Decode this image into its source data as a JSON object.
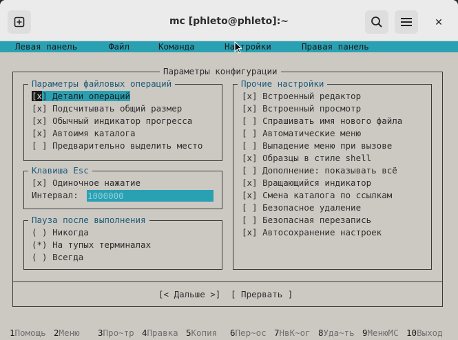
{
  "window": {
    "title": "mc [phleto@phleto]:~",
    "close_glyph": "✕"
  },
  "menubar": {
    "items": [
      "Левая панель",
      "Файл",
      "Команда",
      "Настройки",
      "Правая панель"
    ]
  },
  "dialog": {
    "title": "Параметры конфигурации",
    "file_ops": {
      "title": "Параметры файловых операций",
      "items": [
        {
          "mark": "[x]",
          "label": "Детали операций",
          "checked": true,
          "focused": true
        },
        {
          "mark": "[x]",
          "label": "Подсчитывать общий размер",
          "checked": true
        },
        {
          "mark": "[x]",
          "label": "Обычный индикатор прогресса",
          "checked": true
        },
        {
          "mark": "[x]",
          "label": "Автоимя каталога",
          "checked": true
        },
        {
          "mark": "[ ]",
          "label": "Предварительно выделить место",
          "checked": false
        }
      ]
    },
    "esc_key": {
      "title": "Клавиша Esc",
      "single_press": {
        "mark": "[x]",
        "label": "Одиночное нажатие"
      },
      "interval_label": "Интервал:",
      "interval_value": "1000000"
    },
    "pause": {
      "title": "Пауза после выполнения",
      "options": [
        {
          "mark": "( )",
          "label": "Никогда"
        },
        {
          "mark": "(*)",
          "label": "На тупых терминалах"
        },
        {
          "mark": "( )",
          "label": "Всегда"
        }
      ]
    },
    "other": {
      "title": "Прочие настройки",
      "items": [
        {
          "mark": "[x]",
          "label": "Встроенный редактор"
        },
        {
          "mark": "[x]",
          "label": "Встроенный просмотр"
        },
        {
          "mark": "[ ]",
          "label": "Спрашивать имя нового файла"
        },
        {
          "mark": "[ ]",
          "label": "Автоматические меню"
        },
        {
          "mark": "[ ]",
          "label": "Выпадение меню при вызове"
        },
        {
          "mark": "[x]",
          "label": "Образцы в стиле shell"
        },
        {
          "mark": "[ ]",
          "label": "Дополнение: показывать всё"
        },
        {
          "mark": "[x]",
          "label": "Вращающийся индикатор"
        },
        {
          "mark": "[x]",
          "label": "Смена каталога по ссылкам"
        },
        {
          "mark": "[ ]",
          "label": "Безопасное удаление"
        },
        {
          "mark": "[ ]",
          "label": "Безопасная перезапись"
        },
        {
          "mark": "[x]",
          "label": "Автосохранение настроек"
        }
      ]
    },
    "buttons": {
      "next": "[< Дальше >]",
      "abort": "[ Прервать ]"
    }
  },
  "function_keys": [
    {
      "num": "1",
      "label": "Помощь"
    },
    {
      "num": "2",
      "label": "Меню"
    },
    {
      "num": "3",
      "label": "Про~тр"
    },
    {
      "num": "4",
      "label": "Правка"
    },
    {
      "num": "5",
      "label": "Копия"
    },
    {
      "num": "6",
      "label": "Пер~ос"
    },
    {
      "num": "7",
      "label": "НвК~ог"
    },
    {
      "num": "8",
      "label": "Уда~ть"
    },
    {
      "num": "9",
      "label": "МенюМС"
    },
    {
      "num": "10",
      "label": "Выход"
    }
  ],
  "colors": {
    "accent": "#2aa1b3",
    "hotkey": "#1e6bb0",
    "background": "#ccc9c3"
  }
}
